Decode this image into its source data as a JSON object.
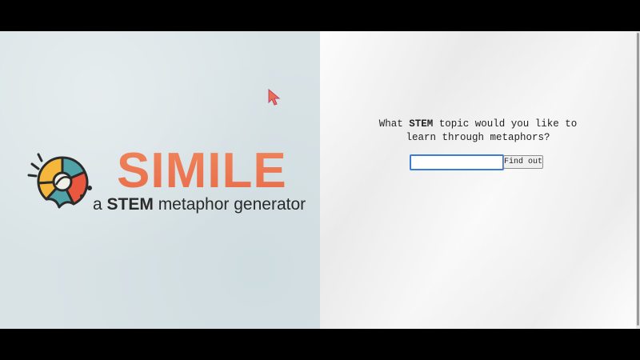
{
  "logo": {
    "title": "SIMILE",
    "tagline_prefix": "a ",
    "tagline_emphasis": "STEM",
    "tagline_suffix": " metaphor generator",
    "brand_color": "#e8704f",
    "icon": "simile-logo-icon"
  },
  "form": {
    "prompt_prefix": "What ",
    "prompt_emphasis": "STEM",
    "prompt_line1_suffix": " topic would you like to",
    "prompt_line2": "learn through metaphors?",
    "input_value": "",
    "input_placeholder": "",
    "button_label": "Find out",
    "focus_color": "#3b7cd6"
  },
  "cursor": {
    "icon": "mouse-pointer-icon",
    "color": "#e8704f"
  }
}
